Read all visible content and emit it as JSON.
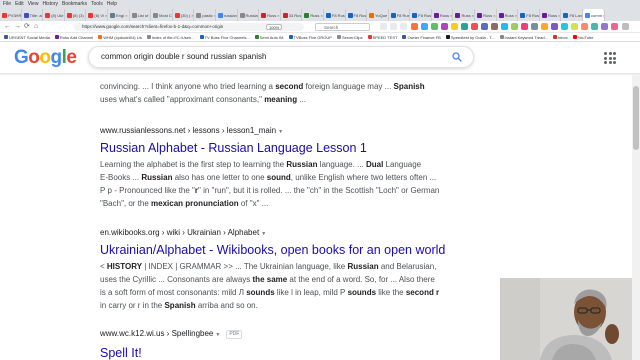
{
  "browser": {
    "menu": [
      "File",
      "Edit",
      "View",
      "History",
      "Bookmarks",
      "Tools",
      "Help"
    ],
    "tabs": [
      {
        "label": "PV3HR",
        "color": "#e53935"
      },
      {
        "label": "Title: an",
        "color": "#3f51b5"
      },
      {
        "label": "(8) Ukr",
        "color": "#e53935"
      },
      {
        "label": "(8) (3)",
        "color": "#e53935"
      },
      {
        "label": "(8) Vi",
        "color": "#e53935"
      },
      {
        "label": "Engl",
        "color": "#607d8b"
      },
      {
        "label": "List of 1",
        "color": "#888888"
      },
      {
        "label": "Most C",
        "color": "#888888"
      },
      {
        "label": "(30) (",
        "color": "#e53935"
      },
      {
        "label": "pastic",
        "color": "#888888"
      },
      {
        "label": "russian",
        "color": "#4285f4"
      },
      {
        "label": "Russian",
        "color": "#888888"
      },
      {
        "label": "Russ",
        "color": "#c62828"
      },
      {
        "label": "33 Russ",
        "color": "#c62828"
      },
      {
        "label": "Russ",
        "color": "#2e7d32"
      },
      {
        "label": "F8 Russ",
        "color": "#1565c0"
      },
      {
        "label": "F8 Russ",
        "color": "#1565c0"
      },
      {
        "label": "YoQue",
        "color": "#ef6c00"
      },
      {
        "label": "F8 Russ",
        "color": "#1565c0"
      },
      {
        "label": "F8 Russ",
        "color": "#1565c0"
      },
      {
        "label": "Russ",
        "color": "#6a1b9a"
      },
      {
        "label": "Russ",
        "color": "#6a1b9a"
      },
      {
        "label": "Russ",
        "color": "#6a1b9a"
      },
      {
        "label": "Russ",
        "color": "#6a1b9a"
      },
      {
        "label": "F8 Russ",
        "color": "#1565c0"
      },
      {
        "label": "Russ",
        "color": "#6a1b9a"
      },
      {
        "label": "F8 Lang",
        "color": "#1565c0"
      },
      {
        "label": "comm",
        "color": "#4285f4"
      }
    ],
    "nav": {
      "back": "←",
      "forward": "→",
      "reload": "⟳",
      "home": "⌂"
    },
    "url": "https://www.google.com/search?client=firefox-b-1-d&q=common+origin",
    "zoom": "100%",
    "search_placeholder": "Search",
    "bookmarks": [
      {
        "label": "URGENT Social Media",
        "color": "#3b5998"
      },
      {
        "label": "Roku Add Channel",
        "color": "#6a1b9a"
      },
      {
        "label": "WHM (cpdudet04) Lis",
        "color": "#ff6d00"
      },
      {
        "label": "Index of file:///C:/Usen...",
        "color": "#888888"
      },
      {
        "label": "TV Boss Five Channels...",
        "color": "#1565c0"
      },
      {
        "label": "Semi Auto IM",
        "color": "#2e7d32"
      },
      {
        "label": "TVBoss Five GROUP",
        "color": "#1565c0"
      },
      {
        "label": "ServerClips",
        "color": "#888888"
      },
      {
        "label": "SPEED TEST",
        "color": "#e53935"
      },
      {
        "label": "Owner Finance FB",
        "color": "#3b5998"
      },
      {
        "label": "Speedtest by Ookla - T...",
        "color": "#141526"
      },
      {
        "label": "Instant Keyword Tread...",
        "color": "#888888"
      },
      {
        "label": "Inbox",
        "color": "#d93025"
      },
      {
        "label": "YouTube",
        "color": "#ff0000"
      }
    ]
  },
  "google": {
    "logo_letters": [
      {
        "ch": "G",
        "color": "#4285f4"
      },
      {
        "ch": "o",
        "color": "#ea4335"
      },
      {
        "ch": "o",
        "color": "#fbbc05"
      },
      {
        "ch": "g",
        "color": "#4285f4"
      },
      {
        "ch": "l",
        "color": "#34a853"
      },
      {
        "ch": "e",
        "color": "#ea4335"
      }
    ],
    "query": "common origin double r sound russian spanish"
  },
  "results": {
    "r0": {
      "line1_a": "convincing. ... I think anyone who tried learning a ",
      "line1_b": "second",
      "line1_c": " foreign language may ... ",
      "line1_d": "Spanish",
      "line2_a": "uses what's called \"approximant consonants,\" ",
      "line2_b": "meaning",
      "line2_c": " ..."
    },
    "r1": {
      "cite": "www.russianlessons.net › lessons › lesson1_main",
      "title": "Russian Alphabet - Russian Language Lesson 1",
      "l1_a": "Learning the alphabet is the first step to learning the ",
      "l1_b": "Russian",
      "l1_c": " language. ... ",
      "l1_d": "Dual",
      "l1_e": " Language",
      "l2_a": "E-Books ... ",
      "l2_b": "Russian",
      "l2_c": " also has one letter to one ",
      "l2_d": "sound",
      "l2_e": ", unlike English where two letters often ...",
      "l3_a": "Р р - Pronounced like the \"",
      "l3_b": "r",
      "l3_c": "\" in \"run\", but it is rolled. ... the \"ch\" in the Scottish \"Loch\" or German",
      "l4_a": "\"Bach\", or the ",
      "l4_b": "mexican pronunciation",
      "l4_c": " of \"x\" ..."
    },
    "r2": {
      "cite": "en.wikibooks.org › wiki › Ukrainian › Alphabet",
      "title": "Ukrainian/Alphabet - Wikibooks, open books for an open world",
      "l1_a": "< ",
      "l1_b": "HISTORY",
      "l1_c": " | INDEX | GRAMMAR >> ... The Ukrainian language, like ",
      "l1_d": "Russian",
      "l1_e": " and Belarusian,",
      "l2_a": "uses the Cyrillic ... Consonants are always ",
      "l2_b": "the same",
      "l2_c": " at the end of a word. So, for ... Also there",
      "l3_a": "is a soft form of most consonants: mild Л ",
      "l3_b": "sounds",
      "l3_c": " like l in leap, mild Р ",
      "l3_d": "sounds",
      "l3_e": " like the ",
      "l3_f": "second r",
      "l4_a": "in carry or r in the ",
      "l4_b": "Spanish",
      "l4_c": " arriba and so on."
    },
    "r3": {
      "cite": "www.wc.k12.wi.us › Spellingbee",
      "pdf": "PDF",
      "title": "Spell It!"
    }
  }
}
